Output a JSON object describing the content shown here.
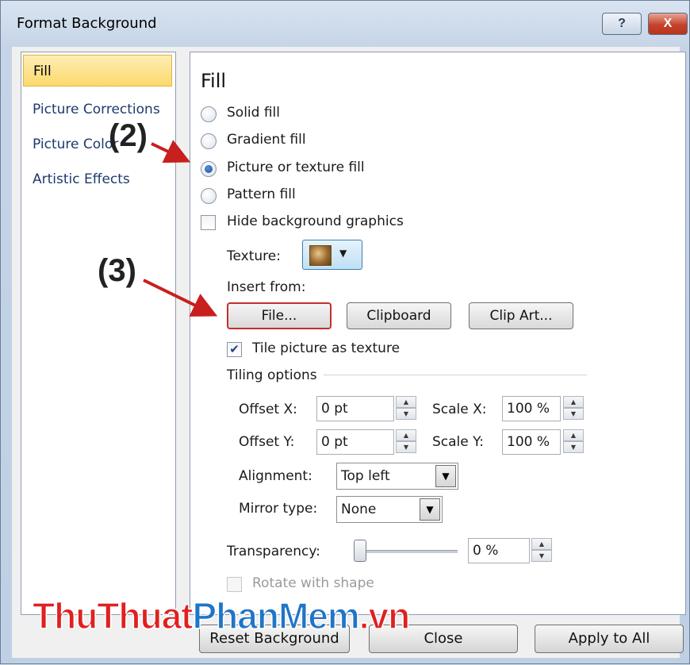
{
  "window": {
    "title": "Format Background",
    "help_glyph": "?",
    "close_glyph": "X"
  },
  "sidebar": {
    "items": [
      {
        "label": "Fill",
        "selected": true
      },
      {
        "label": "Picture Corrections"
      },
      {
        "label": "Picture Color"
      },
      {
        "label": "Artistic Effects"
      }
    ]
  },
  "fill": {
    "heading": "Fill",
    "options": [
      {
        "label": "Solid fill",
        "checked": false
      },
      {
        "label": "Gradient fill",
        "checked": false
      },
      {
        "label": "Picture or texture fill",
        "checked": true
      },
      {
        "label": "Pattern fill",
        "checked": false
      }
    ],
    "hide_bg": {
      "label": "Hide background graphics",
      "checked": false
    },
    "texture_label": "Texture:",
    "insert_from": "Insert from:",
    "buttons": {
      "file": "File...",
      "clipboard": "Clipboard",
      "clipart": "Clip Art..."
    },
    "tile": {
      "label": "Tile picture as texture",
      "checked": true
    },
    "tiling_options": "Tiling options",
    "offset_x": {
      "label": "Offset X:",
      "value": "0 pt"
    },
    "offset_y": {
      "label": "Offset Y:",
      "value": "0 pt"
    },
    "scale_x": {
      "label": "Scale X:",
      "value": "100 %"
    },
    "scale_y": {
      "label": "Scale Y:",
      "value": "100 %"
    },
    "alignment": {
      "label": "Alignment:",
      "value": "Top left"
    },
    "mirror": {
      "label": "Mirror type:",
      "value": "None"
    },
    "transparency": {
      "label": "Transparency:",
      "value": "0 %",
      "level": 0
    },
    "rotate": {
      "label": "Rotate with shape",
      "checked": false,
      "disabled": true
    }
  },
  "footer": {
    "reset": "Reset Background",
    "close": "Close",
    "apply_all": "Apply to All"
  },
  "annotations": {
    "step2": "(2)",
    "step3": "(3)"
  },
  "watermark": {
    "part1": "ThuThuat",
    "part2": "PhanMem",
    "part3": ".vn"
  },
  "colors": {
    "annotation_arrow": "#c8201e",
    "selected_nav": "#fbd96d",
    "watermark_red": "#e02020",
    "watermark_blue": "#1f75c8"
  }
}
